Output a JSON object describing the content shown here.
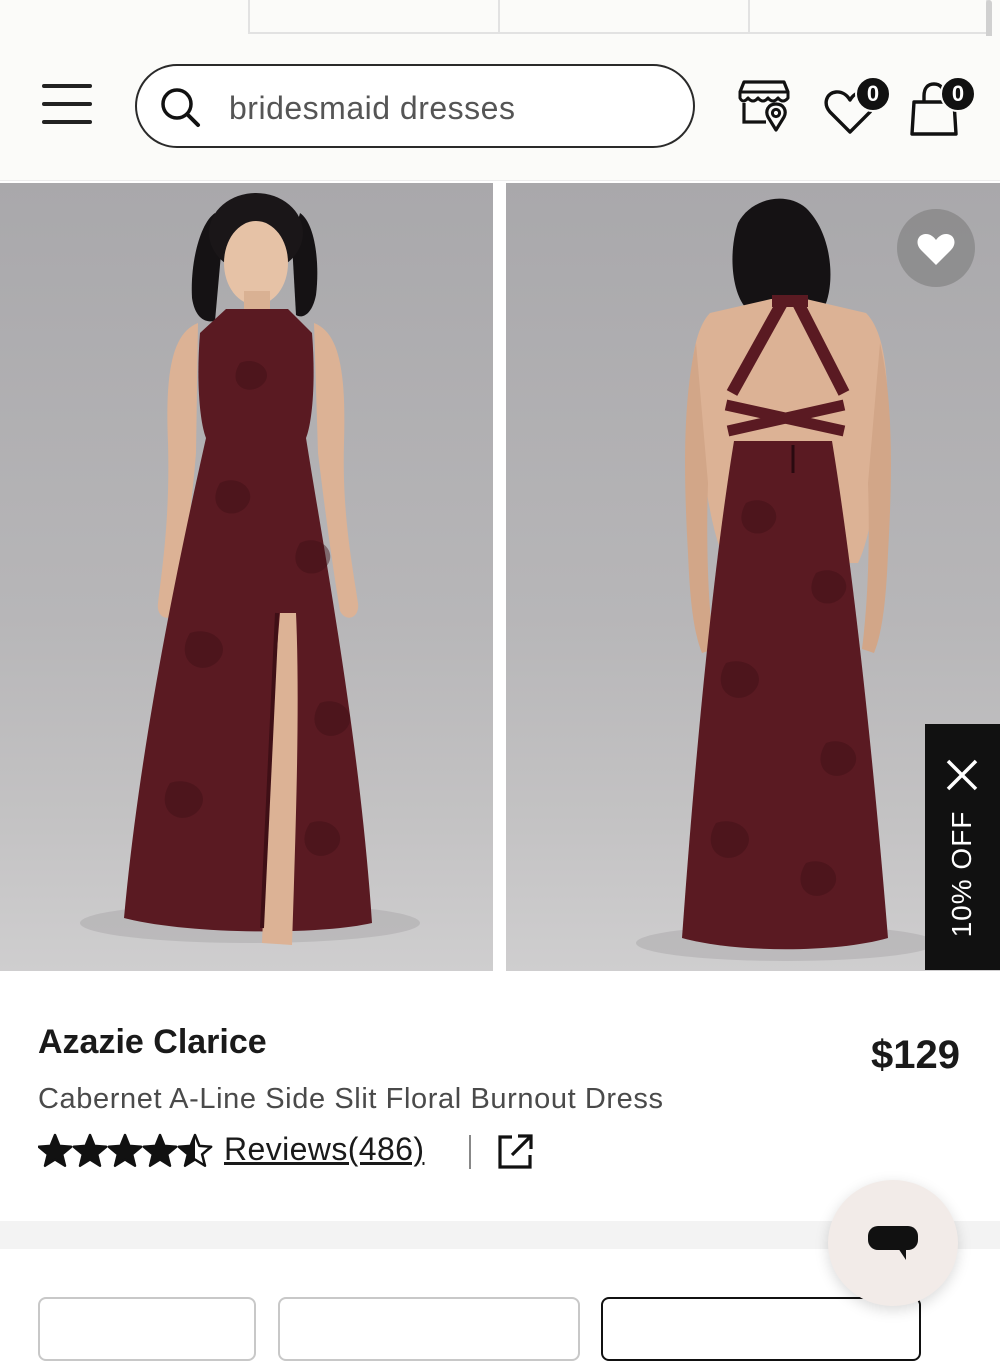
{
  "header": {
    "search": {
      "value": "bridesmaid dresses",
      "placeholder": "Search"
    },
    "favorites_count": "0",
    "cart_count": "0",
    "icons": [
      "menu-icon",
      "search-icon",
      "store-locator-icon",
      "heart-icon",
      "shopping-bag-icon"
    ]
  },
  "gallery": {
    "photos": [
      "front-view",
      "back-view"
    ],
    "favorite_icon": "heart-icon"
  },
  "promo": {
    "label": "10% OFF",
    "close_icon": "close-icon"
  },
  "product": {
    "brand": "Azazie Clarice",
    "price": "$129",
    "description": "Cabernet A-Line Side Slit Floral Burnout Dress",
    "rating": 4.5,
    "rating_max": 5,
    "reviews_label": "Reviews(486)",
    "share_icon": "external-link-icon"
  },
  "colors": {
    "dress": "#5a1a22",
    "accent": "#111111",
    "background": "#fbfbf9",
    "chat_button": "#f2ebe8"
  }
}
